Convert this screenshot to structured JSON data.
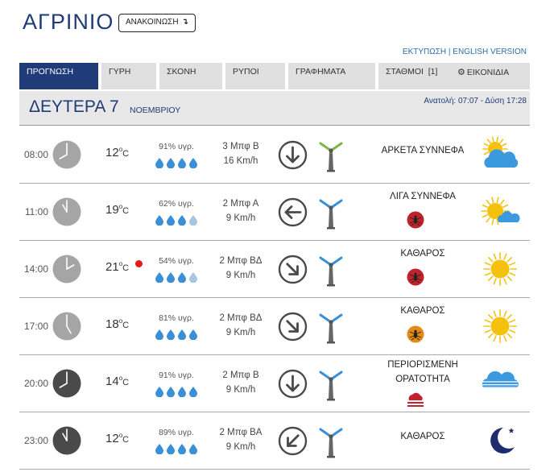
{
  "header": {
    "city": "ΑΓΡΙΝΙΟ",
    "announce_label": "ΑΝΑΚΟΙΝΩΣΗ",
    "announce_arrow": "↴",
    "print_label": "ΕΚΤΥΠΩΣΗ",
    "separator": " | ",
    "english_label": "ENGLISH VERSION"
  },
  "tabs": [
    {
      "label": "ΠΡΟΓΝΩΣΗ",
      "active": true
    },
    {
      "label": "ΓΥΡΗ"
    },
    {
      "label": "ΣΚΟΝΗ"
    },
    {
      "label": "ΡΥΠΟΙ"
    },
    {
      "label": "ΓΡΑΦΗΜΑΤΑ"
    },
    {
      "label": "ΣΤΑΘΜΟΙ  [1]"
    },
    {
      "label": "ΕΙΚΟΝΙΔΙΑ",
      "icon": "gear-icon"
    }
  ],
  "day": {
    "name": "ΔΕΥΤΕΡΑ 7",
    "month": "ΝΟΕΜΒΡΙΟΥ",
    "sun": "Ανατολή: 07:07  - Δύση 17:28"
  },
  "colors": {
    "brand": "#1f3b78",
    "drop_full": "#3a8fd6",
    "drop_empty": "#a8c6df",
    "clock_day": "#a5a5a5",
    "clock_night": "#4a4a4a",
    "badge_red": "#c0232b",
    "badge_orange": "#e28a14",
    "sun": "#f4c20d",
    "cloud_blue": "#3b99e0"
  },
  "forecast": [
    {
      "time": "08:00",
      "hour": 8,
      "night": false,
      "temp": "12",
      "hot": false,
      "humidity": "91% υγρ.",
      "drops_filled": 4,
      "wind_beaufort": "3 Μπφ Β",
      "wind_speed": "16 Km/h",
      "wind_arrow": "down-arrow-icon",
      "turbine_color": "#7ab648",
      "cond_lines": [
        "ΑΡΚΕΤΑ ΣΥΝΝΕΦΑ"
      ],
      "badge": null,
      "weather_icon": "partly-cloudy-icon"
    },
    {
      "time": "11:00",
      "hour": 11,
      "night": false,
      "temp": "19",
      "hot": false,
      "humidity": "62% υγρ.",
      "drops_filled": 3,
      "wind_beaufort": "2 Μπφ Α",
      "wind_speed": "9 Km/h",
      "wind_arrow": "left-arrow-icon",
      "turbine_color": "#3a8fd6",
      "cond_lines": [
        "ΛΙΓΑ ΣΥΝΝΕΦΑ"
      ],
      "badge": "red-mosquito-badge",
      "weather_icon": "few-clouds-icon"
    },
    {
      "time": "14:00",
      "hour": 14,
      "night": false,
      "temp": "21",
      "hot": true,
      "humidity": "54% υγρ.",
      "drops_filled": 3,
      "wind_beaufort": "2 Μπφ ΒΔ",
      "wind_speed": "9 Km/h",
      "wind_arrow": "down-right-arrow-icon",
      "turbine_color": "#3a8fd6",
      "cond_lines": [
        "ΚΑΘΑΡΟΣ"
      ],
      "badge": "red-mosquito-badge",
      "weather_icon": "sun-icon"
    },
    {
      "time": "17:00",
      "hour": 17,
      "night": false,
      "temp": "18",
      "hot": false,
      "humidity": "81% υγρ.",
      "drops_filled": 4,
      "wind_beaufort": "2 Μπφ ΒΔ",
      "wind_speed": "9 Km/h",
      "wind_arrow": "down-right-arrow-icon",
      "turbine_color": "#3a8fd6",
      "cond_lines": [
        "ΚΑΘΑΡΟΣ"
      ],
      "badge": "orange-mosquito-badge",
      "weather_icon": "sun-icon"
    },
    {
      "time": "20:00",
      "hour": 20,
      "night": true,
      "temp": "14",
      "hot": false,
      "humidity": "91% υγρ.",
      "drops_filled": 4,
      "wind_beaufort": "2 Μπφ Β",
      "wind_speed": "9 Km/h",
      "wind_arrow": "down-arrow-icon",
      "turbine_color": "#3a8fd6",
      "cond_lines": [
        "ΠΕΡΙΟΡΙΣΜΕΝΗ",
        "ΟΡΑΤΟΤΗΤΑ"
      ],
      "badge": "red-fog-badge",
      "weather_icon": "fog-icon"
    },
    {
      "time": "23:00",
      "hour": 23,
      "night": true,
      "temp": "12",
      "hot": false,
      "humidity": "89% υγρ.",
      "drops_filled": 4,
      "wind_beaufort": "2 Μπφ ΒΑ",
      "wind_speed": "9 Km/h",
      "wind_arrow": "down-left-arrow-icon",
      "turbine_color": "#3a8fd6",
      "cond_lines": [
        "ΚΑΘΑΡΟΣ"
      ],
      "badge": null,
      "weather_icon": "moon-icon"
    }
  ],
  "units": {
    "degree": "o",
    "celsius": "C"
  }
}
